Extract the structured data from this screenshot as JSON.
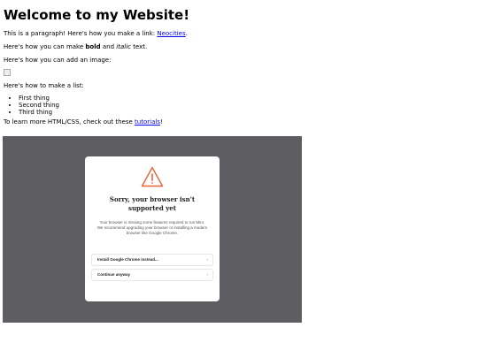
{
  "page": {
    "title": "Welcome to my Website!",
    "p1_text": "This is a paragraph! Here's how you make a link: ",
    "p1_link": "Neocities",
    "p1_end": ".",
    "p2_a": "Here's how you can make ",
    "p2_bold": "bold",
    "p2_b": " and ",
    "p2_italic": "italic",
    "p2_c": " text.",
    "p3_text": "Here's how you can add an image:",
    "p4_text": "Here's how to make a list:",
    "list": [
      "First thing",
      "Second thing",
      "Third thing"
    ],
    "p5_text": "To learn more HTML/CSS, check out these ",
    "p5_link": "tutorials",
    "p5_end": "!"
  },
  "dialog": {
    "title": "Sorry, your browser isn't supported yet",
    "desc_1": "Your browser is missing some features required to run Miro.",
    "desc_2": "We recommend upgrading your browser or installing a modern browser like Google Chrome.",
    "option_1": "Install Google Chrome instead...",
    "option_2": "Continue anyway",
    "warning_color": "#e8643a",
    "overlay_color": "#5e5d61"
  }
}
